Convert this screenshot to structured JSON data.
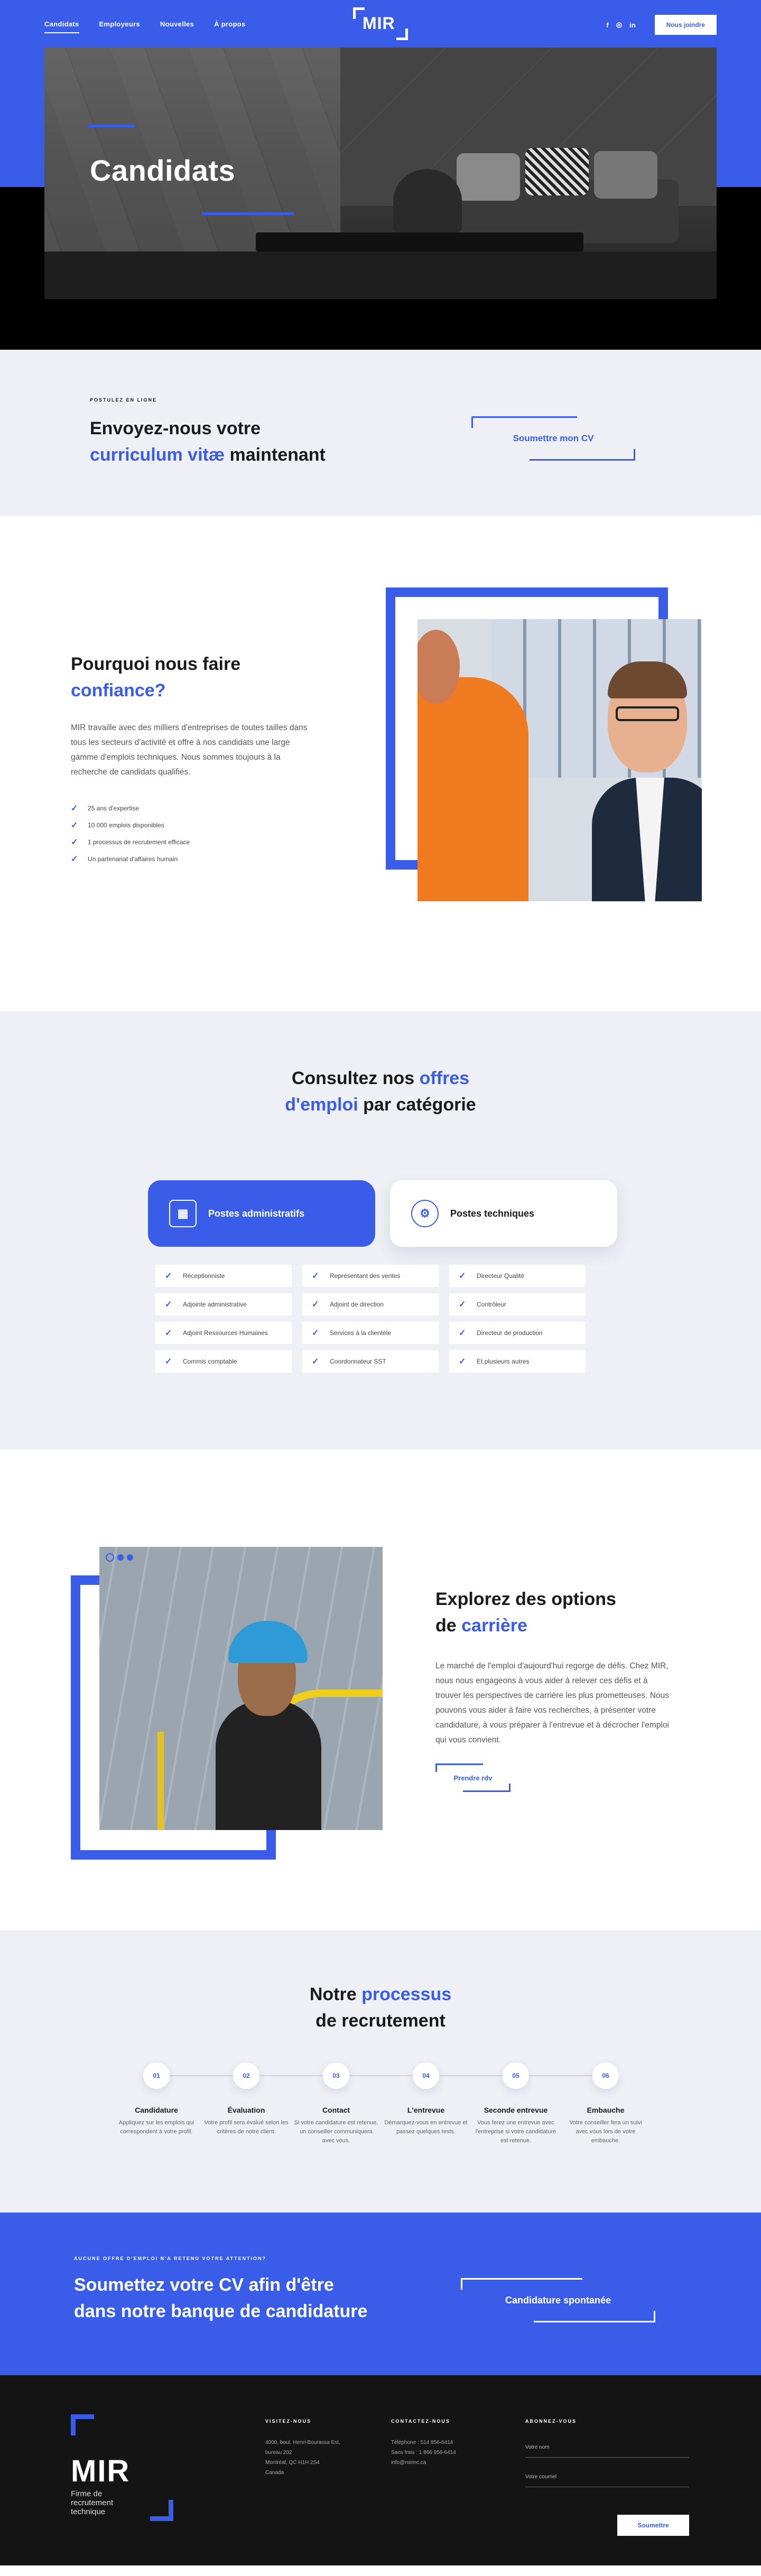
{
  "nav": {
    "links": [
      "Candidats",
      "Employeurs",
      "Nouvelles",
      "À propos"
    ],
    "logo": "MIR",
    "social": [
      "f",
      "◎",
      "in"
    ],
    "join_label": "Nous joindre"
  },
  "hero": {
    "title": "Candidats"
  },
  "cv": {
    "eyebrow": "POSTULEZ EN LIGNE",
    "title_line1": "Envoyez-nous votre",
    "title_accent": "curriculum vitæ",
    "title_rest": " maintenant",
    "button": "Soumettre mon CV"
  },
  "why": {
    "title_line1": "Pourquoi nous faire",
    "title_accent": "confiance?",
    "text": "MIR travaille avec des milliers d'entreprises de toutes tailles dans tous les secteurs d'activité et offre à nos candidats une large gamme d'emplois techniques. Nous sommes toujours à la recherche de candidats qualifiés.",
    "items": [
      "25 ans d'expertise",
      "10 000 emplois disponibles",
      "1 processus de recrutement efficace",
      "Un partenariat d'affaires humain"
    ]
  },
  "categories": {
    "title_pre": "Consultez nos ",
    "title_accent1": "offres",
    "title_accent2": "d'emploi",
    "title_post": " par catégorie",
    "tab_active": "Postes administratifs",
    "tab_inactive": "Postes techniques",
    "items": [
      "Réceptionniste",
      "Représentant des ventes",
      "Directeur Qualité",
      "Adjointe administrative",
      "Adjoint de direction",
      "Contrôleur",
      "Adjoint Ressources Humaines",
      "Services à la clientèle",
      "Directeur de production",
      "Commis comptable",
      "Coordonnateur SST",
      "Et plusieurs autres"
    ]
  },
  "explore": {
    "title_line1": "Explorez des options",
    "title_pre": "de ",
    "title_accent": "carrière",
    "text": "Le marché de l'emploi d'aujourd'hui regorge de défis. Chez MIR, nous nous engageons à vous aider à relever ces défis et à trouver les perspectives de carrière les plus prometteuses. Nous pouvons vous aider à faire vos recherches, à présenter votre candidature, à vous préparer à l'entrevue et à décrocher l'emploi qui vous convient.",
    "button": "Prendre rdv"
  },
  "process": {
    "title_pre": "Notre ",
    "title_accent": "processus",
    "title_line2": "de recrutement",
    "steps": [
      {
        "num": "01",
        "title": "Candidature",
        "text": "Appliquez sur les emplois qui correspondent à votre profil."
      },
      {
        "num": "02",
        "title": "Évaluation",
        "text": "Votre profil sera évalué selon les critères de notre client."
      },
      {
        "num": "03",
        "title": "Contact",
        "text": "Si votre candidature est retenue, un conseiller communiquera avec vous."
      },
      {
        "num": "04",
        "title": "L'entrevue",
        "text": "Démarquez-vous en entrevue et passez quelques tests."
      },
      {
        "num": "05",
        "title": "Seconde entrevue",
        "text": "Vous ferez une entrevue avec l'entreprise si votre candidature est retenue."
      },
      {
        "num": "06",
        "title": "Embauche",
        "text": "Votre conseiller fera un suivi avec vous lors de votre embauche."
      }
    ]
  },
  "cta": {
    "eyebrow": "AUCUNE OFFRE D'EMPLOI N'A RETENU VOTRE ATTENTION?",
    "title_line1": "Soumettez votre CV afin d'être",
    "title_line2": "dans notre banque de candidature",
    "button": "Candidature spontanée"
  },
  "footer": {
    "logo": "MIR",
    "subtitle_lines": [
      "Firme de",
      "recrutement",
      "technique"
    ],
    "visit_head": "VISITEZ-NOUS",
    "visit_lines": [
      "4000, boul. Henri-Bourassa Est,",
      "bureau 202",
      "Montréal, QC H1H 2S4",
      "Canada"
    ],
    "contact_head": "CONTACTEZ-NOUS",
    "contact_lines": [
      "Téléphone : 514 856-6414",
      "Sans frais : 1 866 956-6414",
      "info@mirinc.ca"
    ],
    "subscribe_head": "ABONNEZ-VOUS",
    "name_placeholder": "Votre nom",
    "email_placeholder": "Votre courriel",
    "submit": "Soumettre"
  }
}
